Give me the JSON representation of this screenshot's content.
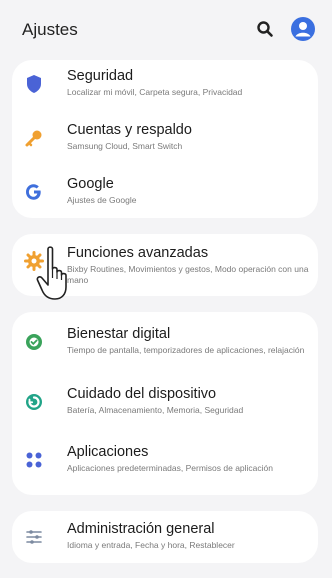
{
  "header": {
    "title": "Ajustes"
  },
  "groups": [
    {
      "items": [
        {
          "title": "Seguridad",
          "subtitle": "Localizar mi móvil, Carpeta segura, Privacidad",
          "icon": "shield-icon"
        },
        {
          "title": "Cuentas y respaldo",
          "subtitle": "Samsung Cloud, Smart Switch",
          "icon": "key-icon"
        },
        {
          "title": "Google",
          "subtitle": "Ajustes de Google",
          "icon": "google-icon"
        }
      ]
    },
    {
      "items": [
        {
          "title": "Funciones avanzadas",
          "subtitle": "Bixby Routines, Movimientos y gestos, Modo operación con una mano",
          "icon": "gear-star-icon"
        }
      ]
    },
    {
      "items": [
        {
          "title": "Bienestar digital",
          "subtitle": "Tiempo de pantalla, temporizadores de aplicaciones, relajación",
          "icon": "wellbeing-icon"
        },
        {
          "title": "Cuidado del dispositivo",
          "subtitle": "Batería, Almacenamiento, Memoria, Seguridad",
          "icon": "device-care-icon"
        },
        {
          "title": "Aplicaciones",
          "subtitle": "Aplicaciones predeterminadas, Permisos de aplicación",
          "icon": "apps-grid-icon"
        }
      ]
    },
    {
      "items": [
        {
          "title": "Administración general",
          "subtitle": "Idioma y entrada, Fecha y hora, Restablecer",
          "icon": "sliders-icon"
        }
      ]
    }
  ],
  "colors": {
    "accent": "#3a6fe0",
    "security": "#4a63d6",
    "accounts": "#f0a030",
    "google": "#3f6fdc",
    "advanced": "#f0a030",
    "wellbeing": "#3aa35b",
    "device_care": "#21a488",
    "apps": "#4a63d6",
    "general": "#7c8aa0"
  }
}
